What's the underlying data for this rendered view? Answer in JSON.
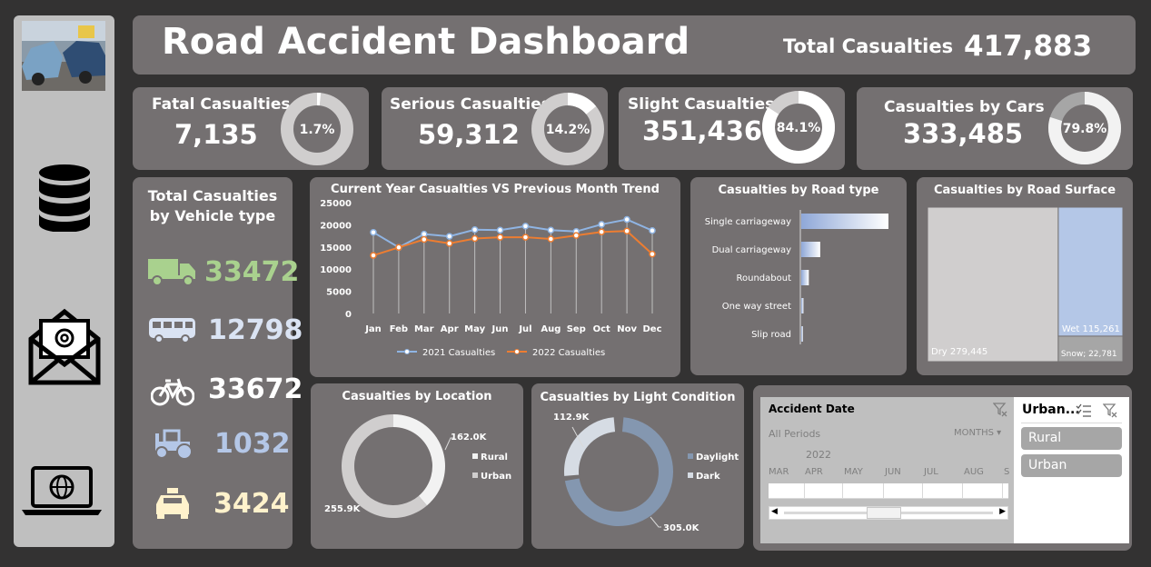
{
  "header": {
    "title": "Road Accident Dashboard",
    "total_label": "Total Casualties",
    "total_value": "417,883"
  },
  "kpis": [
    {
      "title": "Fatal Casualties",
      "value": "7,135",
      "pct_label": "1.7%",
      "pct": 0.017
    },
    {
      "title": "Serious Casualties",
      "value": "59,312",
      "pct_label": "14.2%",
      "pct": 0.142
    },
    {
      "title": "Slight Casualties",
      "value": "351,436",
      "pct_label": "84.1%",
      "pct": 0.841
    },
    {
      "title": "Casualties by Cars",
      "value": "333,485",
      "pct_label": "79.8%",
      "pct": 0.798
    }
  ],
  "vehicle": {
    "title_line1": "Total Casualties",
    "title_line2": "by Vehicle type",
    "items": [
      {
        "icon": "truck-icon",
        "value": "33472",
        "color": "#a9d18e"
      },
      {
        "icon": "bus-icon",
        "value": "12798",
        "color": "#dae3f3"
      },
      {
        "icon": "bicycle-icon",
        "value": "33672",
        "color": "#ffffff"
      },
      {
        "icon": "tractor-icon",
        "value": "1032",
        "color": "#b4c7e7"
      },
      {
        "icon": "car-icon",
        "value": "3424",
        "color": "#fff2cc"
      }
    ]
  },
  "chart_data": [
    {
      "type": "line",
      "title": "Current Year Casualties VS Previous Month Trend",
      "categories": [
        "Jan",
        "Feb",
        "Mar",
        "Apr",
        "May",
        "Jun",
        "Jul",
        "Aug",
        "Sep",
        "Oct",
        "Nov",
        "Dec"
      ],
      "yticks": [
        "25000",
        "20000",
        "15000",
        "10000",
        "5000",
        "0"
      ],
      "ylim": [
        0,
        25000
      ],
      "series": [
        {
          "name": "2021 Casualties",
          "color": "#8fb4e3",
          "values": [
            18300,
            14900,
            17900,
            17400,
            18900,
            18800,
            19700,
            18800,
            18500,
            20100,
            21200,
            18700
          ]
        },
        {
          "name": "2022 Casualties",
          "color": "#ed7d31",
          "values": [
            13100,
            14900,
            16700,
            15800,
            16900,
            17200,
            17200,
            16800,
            17600,
            18400,
            18600,
            13400
          ]
        }
      ]
    },
    {
      "type": "bar",
      "title": "Casualties by Road type",
      "categories": [
        "Single carriageway",
        "Dual carriageway",
        "Roundabout",
        "One way street",
        "Slip road"
      ],
      "values": [
        309700,
        67400,
        26900,
        7900,
        5900
      ]
    },
    {
      "type": "heatmap",
      "title": "Casualties by Road Surface",
      "items": [
        {
          "name": "Dry",
          "label": "Dry 279,445",
          "value": 279445
        },
        {
          "name": "Wet",
          "label": "Wet 115,261",
          "value": 115261
        },
        {
          "name": "Snow",
          "label": "Snow; 22,781",
          "value": 22781
        }
      ]
    },
    {
      "type": "pie",
      "title": "Casualties by Location",
      "slices": [
        {
          "name": "Rural",
          "label": "162.0K",
          "value": 162000
        },
        {
          "name": "Urban",
          "label": "255.9K",
          "value": 255900
        }
      ]
    },
    {
      "type": "pie",
      "title": "Casualties by Light Condition",
      "slices": [
        {
          "name": "Daylight",
          "label": "305.0K",
          "value": 305000
        },
        {
          "name": "Dark",
          "label": "112.9K",
          "value": 112900
        }
      ]
    }
  ],
  "slicer": {
    "title": "Accident Date",
    "periods": "All Periods",
    "granularity": "MONTHS",
    "year": "2022",
    "months": [
      "MAR",
      "APR",
      "MAY",
      "JUN",
      "JUL",
      "AUG",
      "S"
    ],
    "urban_title": "Urban...",
    "urban_options": [
      "Rural",
      "Urban"
    ]
  }
}
